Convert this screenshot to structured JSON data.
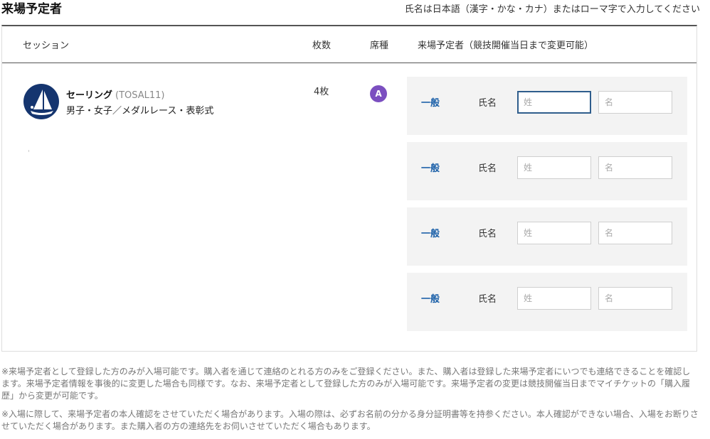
{
  "header": {
    "title": "来場予定者",
    "note": "氏名は日本語（漢字・かな・カナ）またはローマ字で入力してください"
  },
  "table": {
    "columns": {
      "session": "セッション",
      "count": "枚数",
      "seat": "席種",
      "visitor": "来場予定者（競技開催当日まで変更可能）"
    }
  },
  "session": {
    "icon": "sailing-icon",
    "name": "セーリング",
    "code": "(TOSAL11)",
    "description": "男子・女子／メダルレース・表彰式",
    "count": "4枚",
    "seat": "A",
    "seat_color": "#7b4fc0",
    "logo_color": "#15356f"
  },
  "visitors": [
    {
      "type": "一般",
      "label": "氏名",
      "sei_placeholder": "姓",
      "mei_placeholder": "名",
      "sei_value": "",
      "mei_value": ""
    },
    {
      "type": "一般",
      "label": "氏名",
      "sei_placeholder": "姓",
      "mei_placeholder": "名",
      "sei_value": "",
      "mei_value": ""
    },
    {
      "type": "一般",
      "label": "氏名",
      "sei_placeholder": "姓",
      "mei_placeholder": "名",
      "sei_value": "",
      "mei_value": ""
    },
    {
      "type": "一般",
      "label": "氏名",
      "sei_placeholder": "姓",
      "mei_placeholder": "名",
      "sei_value": "",
      "mei_value": ""
    }
  ],
  "notes": [
    "※来場予定者として登録した方のみが入場可能です。購入者を通じて連絡のとれる方のみをご登録ください。また、購入者は登録した来場予定者にいつでも連絡できることを確認します。来場予定者情報を事後的に変更した場合も同様です。なお、来場予定者として登録した方のみが入場可能です。来場予定者の変更は競技開催当日までマイチケットの「購入履歴」から変更が可能です。",
    "※入場に際して、来場予定者の本人確認をさせていただく場合があります。入場の際は、必ずお名前の分かる身分証明書等を持参ください。本人確認ができない場合、入場をお断りさせていただく場合があります。また購入者の方の連絡先をお伺いさせていただく場合もあります。"
  ]
}
